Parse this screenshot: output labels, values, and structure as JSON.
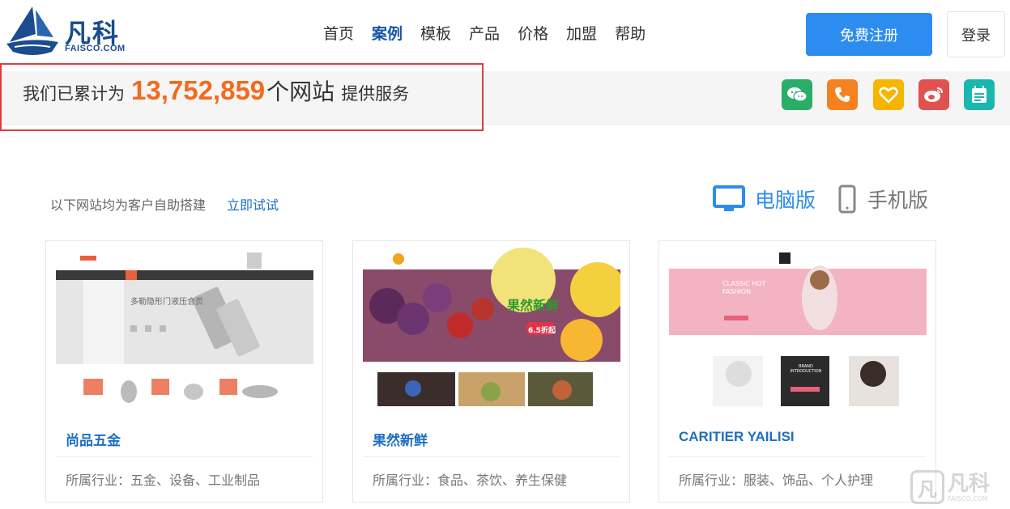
{
  "logo": {
    "brand": "凡科",
    "sub": "FAISCO.COM"
  },
  "nav": {
    "items": [
      "首页",
      "案例",
      "模板",
      "产品",
      "价格",
      "加盟",
      "帮助"
    ],
    "active_index": 1
  },
  "auth": {
    "register": "免费注册",
    "login": "登录"
  },
  "stats": {
    "prefix": "我们已累计为",
    "count": "13,752,859",
    "unit": "个网站",
    "suffix": "提供服务"
  },
  "social": [
    {
      "icon": "wechat-icon",
      "color": "#2aae67"
    },
    {
      "icon": "phone-icon",
      "color": "#f5821f"
    },
    {
      "icon": "heart-icon",
      "color": "#f7b500"
    },
    {
      "icon": "weibo-icon",
      "color": "#e0514f"
    },
    {
      "icon": "notepad-icon",
      "color": "#18b8b0"
    }
  ],
  "intro": {
    "text": "以下网站均为客户自助搭建",
    "link": "立即试试"
  },
  "view_toggle": {
    "pc": "电脑版",
    "mobile": "手机版",
    "active": "pc"
  },
  "cards": [
    {
      "title": "尚品五金",
      "industry": "所属行业：五金、设备、工业制品",
      "thumb": {
        "banner_text": "多勒隐形门液压合页"
      }
    },
    {
      "title": "果然新鲜",
      "industry": "所属行业：食品、茶饮、养生保健",
      "thumb": {
        "banner_text": "果然新鲜",
        "price_tag": "6.5折起"
      }
    },
    {
      "title": "CARITIER YAILISI",
      "industry": "所属行业：服装、饰品、个人护理",
      "thumb": {
        "banner_text": "CLASSIC HOT FASHION",
        "tile_text": "BRAND INTRODUCTION"
      }
    }
  ],
  "watermark": {
    "text": "凡科",
    "sub": "FAISCO.COM"
  },
  "colors": {
    "accent": "#2d8cf0",
    "link": "#1e6fc0",
    "stats_number": "#f26b1d",
    "highlight_box": "#e03b3b"
  }
}
